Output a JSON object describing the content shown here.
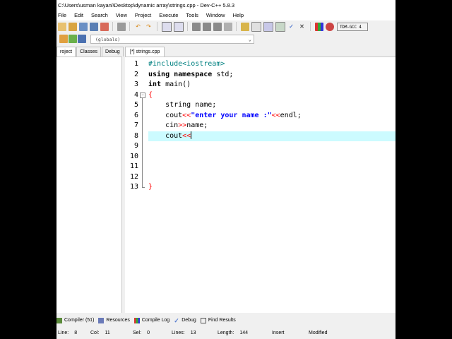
{
  "title": "C:\\Users\\usman kayani\\Desktop\\dynamic array\\strings.cpp - Dev-C++ 5.8.3",
  "menu": [
    "File",
    "Edit",
    "Search",
    "View",
    "Project",
    "Execute",
    "Tools",
    "Window",
    "Help"
  ],
  "toolbar": {
    "compiler_value": "TDM-GCC 4"
  },
  "scope_selector": "(globals)",
  "left_tabs": [
    "roject",
    "Classes",
    "Debug"
  ],
  "file_tab": "[*] strings.cpp",
  "editor": {
    "line_numbers": [
      "1",
      "2",
      "3",
      "4",
      "5",
      "6",
      "7",
      "8",
      "9",
      "10",
      "11",
      "12",
      "13"
    ],
    "current_line": 8
  },
  "code": {
    "l1": "#include<iostream>",
    "l2_kw1": "using",
    "l2_kw2": "namespace",
    "l2_rest": " std;",
    "l3_kw": "int",
    "l3_rest": " main()",
    "l4_brace": "{",
    "l5_text": "    string name;",
    "l6_a": "    cout",
    "l6_b": "<<",
    "l6_c": "\"enter your name :\"",
    "l6_d": "<<",
    "l6_e": "endl;",
    "l7_a": "    cin",
    "l7_b": ">>",
    "l7_c": "name;",
    "l8_a": "    cout",
    "l8_b": "<<",
    "l13_brace": "}"
  },
  "bottom_tabs": [
    "Compiler (51)",
    "Resources",
    "Compile Log",
    "Debug",
    "Find Results"
  ],
  "status": {
    "line_label": "Line:",
    "line_value": "8",
    "col_label": "Col:",
    "col_value": "11",
    "sel_label": "Sel:",
    "sel_value": "0",
    "lines_label": "Lines:",
    "lines_value": "13",
    "length_label": "Length:",
    "length_value": "144",
    "mode": "Insert",
    "state": "Modified"
  },
  "colors": {
    "keyword": "#000000",
    "preprocessor": "#008080",
    "operator": "#ff0000",
    "string": "#0000ff",
    "current_line": "#ccfbff"
  }
}
